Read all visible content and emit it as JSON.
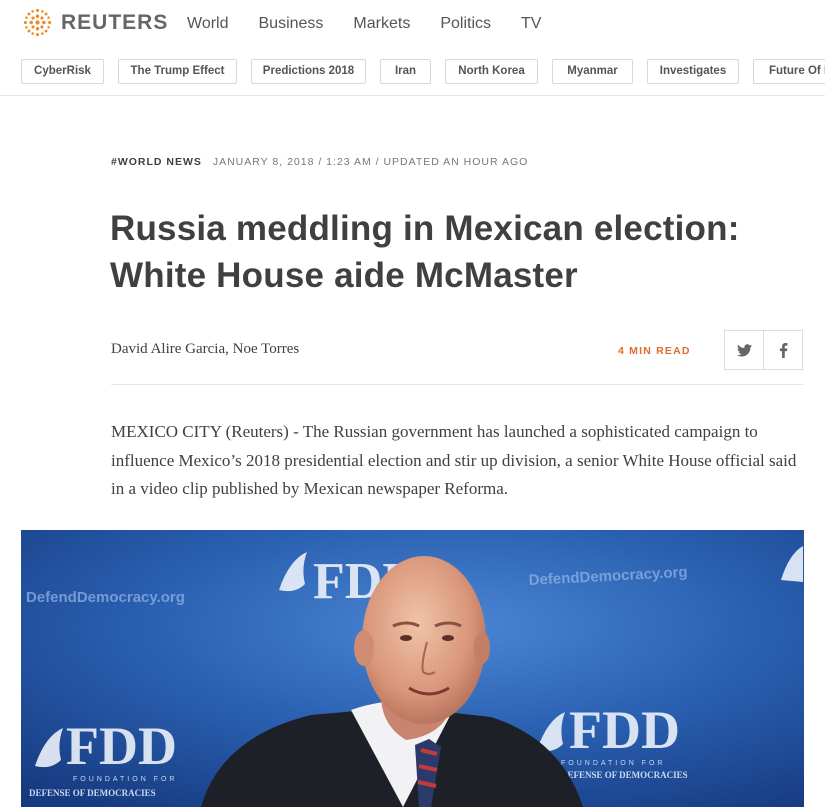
{
  "brand": {
    "name": "REUTERS"
  },
  "nav": {
    "items": [
      "World",
      "Business",
      "Markets",
      "Politics",
      "TV"
    ]
  },
  "topics": [
    "CyberRisk",
    "The Trump Effect",
    "Predictions 2018",
    "Iran",
    "North Korea",
    "Myanmar",
    "Investigates",
    "Future Of M"
  ],
  "article": {
    "section": "#WORLD NEWS",
    "dateline": "JANUARY 8, 2018 / 1:23 AM / UPDATED AN HOUR AGO",
    "headline_line1": "Russia meddling in Mexican election:",
    "headline_line2": "White House aide McMaster",
    "byline": "David Alire Garcia, Noe Torres",
    "read_time": "4 MIN READ",
    "lede": "MEXICO CITY (Reuters) - The Russian government has launched a sophisticated campaign to influence Mexico’s 2018 presidential election and stir up division, a senior White House official said in a video clip published by Mexican newspaper Reforma."
  },
  "photo": {
    "backdrop_text": [
      "DefendDemocracy.org",
      "FDD",
      "FOUNDATION FOR",
      "DEFENSE OF DEMOCRACIES"
    ]
  },
  "icons": {
    "share_twitter": "twitter-icon",
    "share_facebook": "facebook-icon"
  },
  "colors": {
    "accent_orange": "#e06d2c",
    "text": "#404040",
    "photo_blue": "#2458a8"
  }
}
